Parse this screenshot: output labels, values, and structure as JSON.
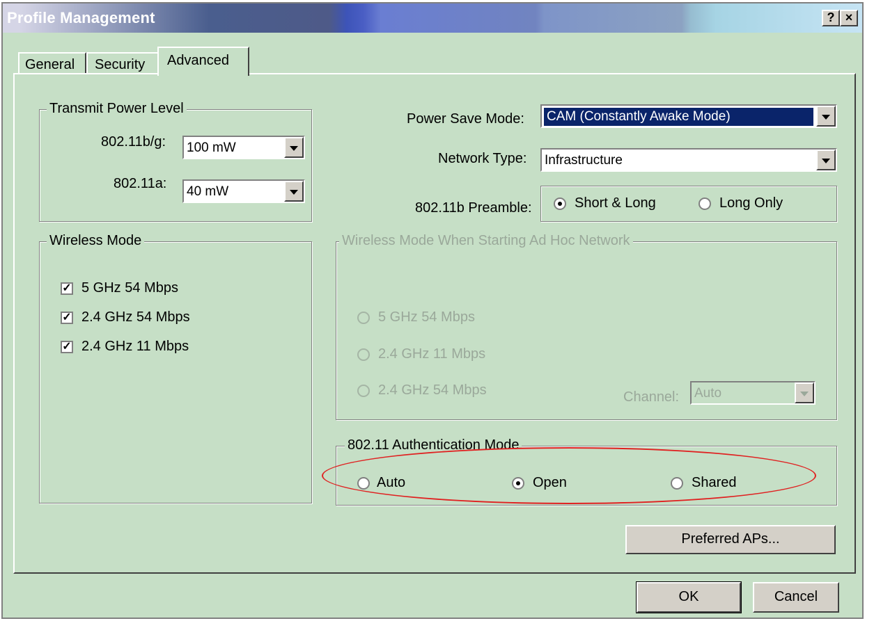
{
  "window": {
    "title": "Profile Management",
    "help_label": "?",
    "close_label": "×"
  },
  "tabs": [
    {
      "label": "General",
      "active": false
    },
    {
      "label": "Security",
      "active": false
    },
    {
      "label": "Advanced",
      "active": true
    }
  ],
  "transmit_power": {
    "group_label": "Transmit Power Level",
    "bg_label": "802.11b/g:",
    "bg_value": "100 mW",
    "a_label": "802.11a:",
    "a_value": "40 mW"
  },
  "wireless_mode": {
    "group_label": "Wireless Mode",
    "options": [
      {
        "label": "5 GHz 54 Mbps",
        "checked": true
      },
      {
        "label": "2.4 GHz 54 Mbps",
        "checked": true
      },
      {
        "label": "2.4 GHz 11 Mbps",
        "checked": true
      }
    ]
  },
  "power_save": {
    "label": "Power Save Mode:",
    "value": "CAM (Constantly Awake Mode)"
  },
  "network_type": {
    "label": "Network Type:",
    "value": "Infrastructure"
  },
  "preamble": {
    "label": "802.11b Preamble:",
    "options": [
      {
        "label": "Short & Long",
        "selected": true
      },
      {
        "label": "Long Only",
        "selected": false
      }
    ]
  },
  "adhoc_mode": {
    "group_label": "Wireless Mode When Starting Ad Hoc Network",
    "options": [
      {
        "label": "5 GHz 54 Mbps",
        "selected": false
      },
      {
        "label": "2.4 GHz 11 Mbps",
        "selected": false
      },
      {
        "label": "2.4 GHz 54 Mbps",
        "selected": false
      }
    ],
    "channel_label": "Channel:",
    "channel_value": "Auto"
  },
  "auth_mode": {
    "group_label": "802.11 Authentication Mode",
    "options": [
      {
        "label": "Auto",
        "selected": false
      },
      {
        "label": "Open",
        "selected": true
      },
      {
        "label": "Shared",
        "selected": false
      }
    ]
  },
  "buttons": {
    "preferred_aps": "Preferred APs...",
    "ok": "OK",
    "cancel": "Cancel"
  },
  "colors": {
    "highlight": "#0a246a",
    "annotation": "#e02020",
    "background": "#c6dfc6"
  }
}
